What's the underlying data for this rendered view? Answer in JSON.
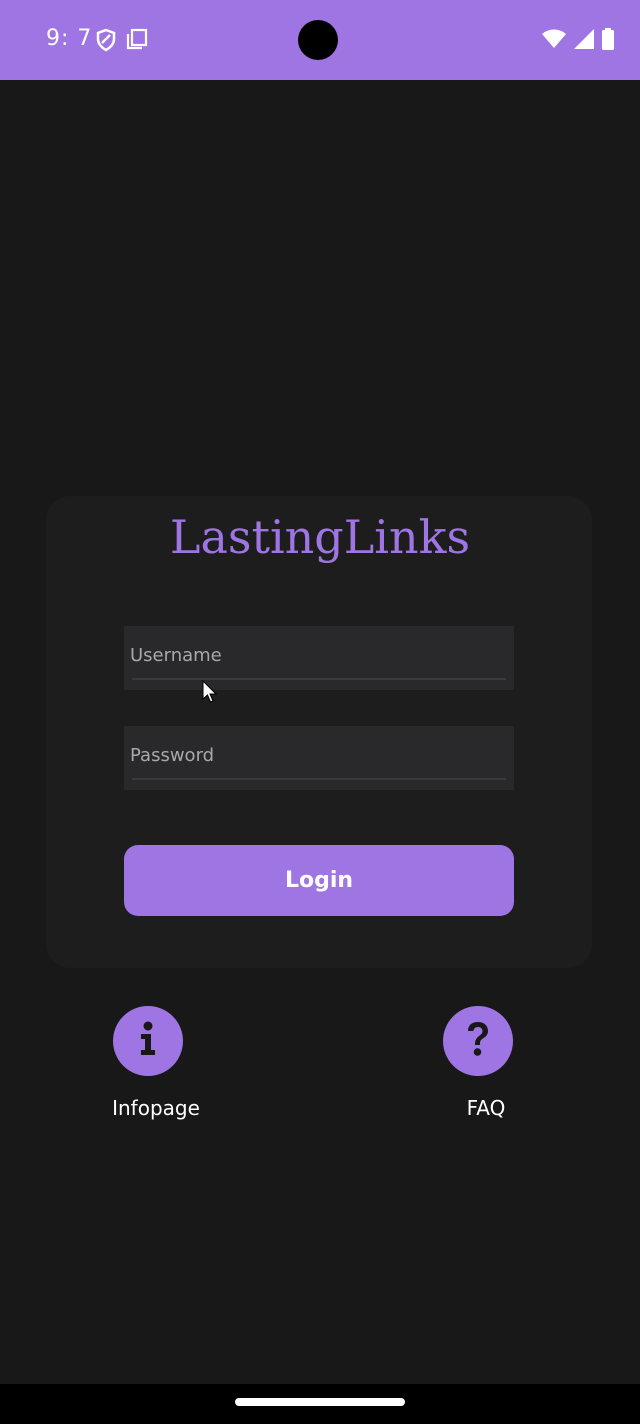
{
  "status_bar": {
    "time": "9: 7",
    "left_icons": [
      "shield-icon",
      "copy-icon"
    ],
    "right_icons": [
      "wifi-icon",
      "signal-icon",
      "battery-icon"
    ]
  },
  "app": {
    "title": "LastingLinks"
  },
  "form": {
    "username_placeholder": "Username",
    "password_placeholder": "Password",
    "login_label": "Login"
  },
  "links": {
    "info_label": "Infopage",
    "info_icon": "info-icon",
    "faq_label": "FAQ",
    "faq_icon": "question-icon"
  },
  "colors": {
    "accent": "#9e75e3",
    "background": "#181818",
    "card": "#1d1d1e",
    "field": "#29292c"
  }
}
